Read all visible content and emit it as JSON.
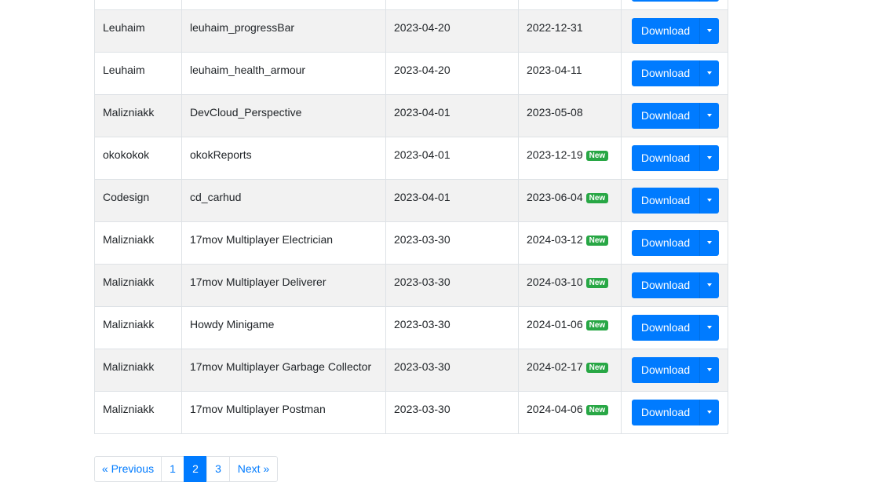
{
  "table": {
    "new_badge_label": "New",
    "download_label": "Download",
    "rows": [
      {
        "author": "",
        "name": "",
        "created": "",
        "updated": "",
        "is_new": false
      },
      {
        "author": "Leuhaim",
        "name": "leuhaim_progressBar",
        "created": "2023-04-20",
        "updated": "2022-12-31",
        "is_new": false
      },
      {
        "author": "Leuhaim",
        "name": "leuhaim_health_armour",
        "created": "2023-04-20",
        "updated": "2023-04-11",
        "is_new": false
      },
      {
        "author": "Malizniakk",
        "name": "DevCloud_Perspective",
        "created": "2023-04-01",
        "updated": "2023-05-08",
        "is_new": false
      },
      {
        "author": "okokokok",
        "name": "okokReports",
        "created": "2023-04-01",
        "updated": "2023-12-19",
        "is_new": true
      },
      {
        "author": "Codesign",
        "name": "cd_carhud",
        "created": "2023-04-01",
        "updated": "2023-06-04",
        "is_new": true
      },
      {
        "author": "Malizniakk",
        "name": "17mov Multiplayer Electrician",
        "created": "2023-03-30",
        "updated": "2024-03-12",
        "is_new": true
      },
      {
        "author": "Malizniakk",
        "name": "17mov Multiplayer Deliverer",
        "created": "2023-03-30",
        "updated": "2024-03-10",
        "is_new": true
      },
      {
        "author": "Malizniakk",
        "name": "Howdy Minigame",
        "created": "2023-03-30",
        "updated": "2024-01-06",
        "is_new": true
      },
      {
        "author": "Malizniakk",
        "name": "17mov Multiplayer Garbage Collector",
        "created": "2023-03-30",
        "updated": "2024-02-17",
        "is_new": true
      },
      {
        "author": "Malizniakk",
        "name": "17mov Multiplayer Postman",
        "created": "2023-03-30",
        "updated": "2024-04-06",
        "is_new": true
      }
    ]
  },
  "pagination": {
    "previous_label": "« Previous",
    "next_label": "Next »",
    "pages": [
      {
        "label": "1",
        "active": false
      },
      {
        "label": "2",
        "active": true
      },
      {
        "label": "3",
        "active": false
      }
    ]
  },
  "colors": {
    "primary": "#007bff",
    "success": "#28a745",
    "row_stripe": "#f2f2f2",
    "border": "#dee2e6"
  }
}
